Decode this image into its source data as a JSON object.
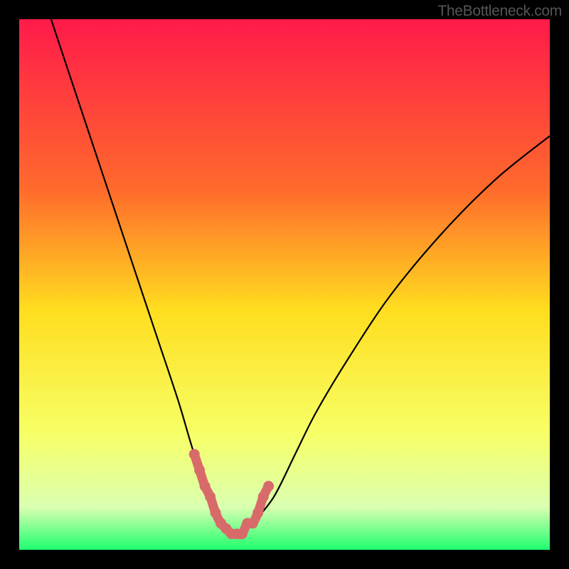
{
  "watermark": "TheBottleneck.com",
  "chart_data": {
    "type": "line",
    "title": "",
    "xlabel": "",
    "ylabel": "",
    "xlim": [
      0,
      100
    ],
    "ylim": [
      0,
      100
    ],
    "grid": false,
    "legend": false,
    "series": [
      {
        "name": "bottleneck-curve",
        "x": [
          6,
          10,
          14,
          18,
          22,
          26,
          30,
          33,
          36,
          38,
          40,
          42,
          44,
          48,
          52,
          56,
          62,
          70,
          80,
          90,
          100
        ],
        "values": [
          100,
          88,
          76,
          64,
          52,
          40,
          28,
          18,
          10,
          5,
          3,
          3,
          5,
          10,
          18,
          26,
          36,
          48,
          60,
          70,
          78
        ]
      },
      {
        "name": "highlighted-minimum",
        "x": [
          33,
          34,
          35,
          36,
          37,
          38,
          39,
          40,
          41,
          42,
          43,
          44,
          45,
          46,
          47
        ],
        "values": [
          18,
          15,
          12,
          10,
          7,
          5,
          4,
          3,
          3,
          3,
          5,
          5,
          7,
          10,
          12
        ]
      }
    ],
    "gradient_stops": [
      {
        "pct": 0,
        "color": "#ff1a4a"
      },
      {
        "pct": 32,
        "color": "#ff6a2c"
      },
      {
        "pct": 55,
        "color": "#ffde1f"
      },
      {
        "pct": 78,
        "color": "#f7ff66"
      },
      {
        "pct": 92,
        "color": "#d9ffb0"
      },
      {
        "pct": 100,
        "color": "#1eff6e"
      }
    ]
  }
}
